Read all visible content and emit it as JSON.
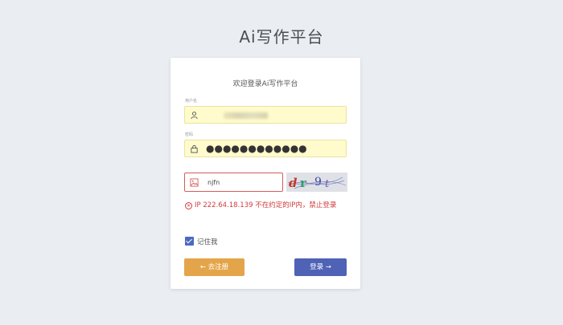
{
  "app": {
    "title": "Ai写作平台"
  },
  "form": {
    "welcome": "欢迎登录Ai写作平台",
    "username_label": "用户名",
    "password_label": "密码",
    "password_value": "●●●●●●●●●●●●",
    "captcha_value": "njfn",
    "captcha_image_text": "dr9t",
    "error": "IP 222.64.18.139 不在约定的IP内，禁止登录",
    "remember_label": "记住我",
    "register_button": "← 去注册",
    "login_button": "登录 →"
  },
  "colors": {
    "background": "#eaeef2",
    "input_fill": "#fffbcc",
    "error": "#d03c3c",
    "register": "#e4a54a",
    "login": "#4f62b5"
  }
}
